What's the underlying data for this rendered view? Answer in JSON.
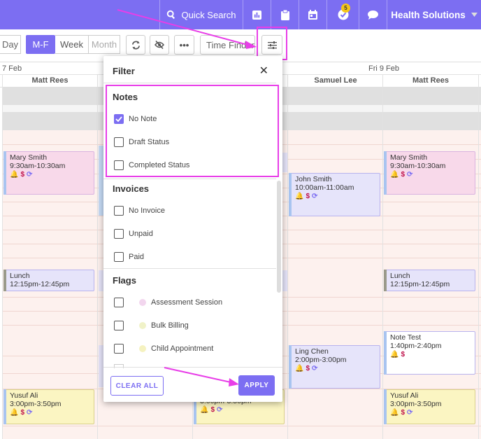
{
  "topbar": {
    "search_label": "Quick Search",
    "org_name": "Health Solutions",
    "task_badge": "5"
  },
  "toolbar": {
    "view_day": "Day",
    "view_mf": "M-F",
    "view_week": "Week",
    "view_month": "Month",
    "time_finder": "Time Finder"
  },
  "calendar": {
    "date_left": "7 Feb",
    "date_right": "Fri 9 Feb",
    "columns": [
      "Matt Rees",
      "Samuel Lee",
      "Matt Rees"
    ],
    "appointments": [
      {
        "name": "Mary Smith",
        "time": "9:30am-10:30am"
      },
      {
        "name": "Mary Smith",
        "time": "9:30am-10:30am"
      },
      {
        "name": "John Smith",
        "time": "10:00am-11:00am"
      },
      {
        "name": "Lunch",
        "time": "12:15pm-12:45pm"
      },
      {
        "name": "Lunch",
        "time": "12:15pm-12:45pm"
      },
      {
        "name": "Note Test",
        "time": "1:40pm-2:40pm"
      },
      {
        "name": "Ling Chen",
        "time": "2:00pm-3:00pm"
      },
      {
        "name": "Yusuf Ali",
        "time": "3:00pm-3:50pm"
      },
      {
        "name": "Yusuf Ali",
        "time": "3:00pm-3:50pm"
      },
      {
        "name": "",
        "time": "3:00pm-3:50pm"
      }
    ]
  },
  "filter": {
    "title": "Filter",
    "close": "✕",
    "sections": {
      "notes": "Notes",
      "invoices": "Invoices",
      "flags": "Flags"
    },
    "notes_options": [
      "No Note",
      "Draft Status",
      "Completed Status"
    ],
    "invoice_options": [
      "No Invoice",
      "Unpaid",
      "Paid"
    ],
    "flag_options": [
      "Assessment Session",
      "Bulk Billing",
      "Child Appointment"
    ],
    "clear_label": "CLEAR ALL",
    "apply_label": "APPLY"
  },
  "colors": {
    "accent": "#7c6ef2",
    "highlight": "#e83ee8",
    "appt_pink": "#f8d9ea",
    "appt_lavender": "#e6e4fa",
    "appt_yellow": "#fbf5c2"
  }
}
